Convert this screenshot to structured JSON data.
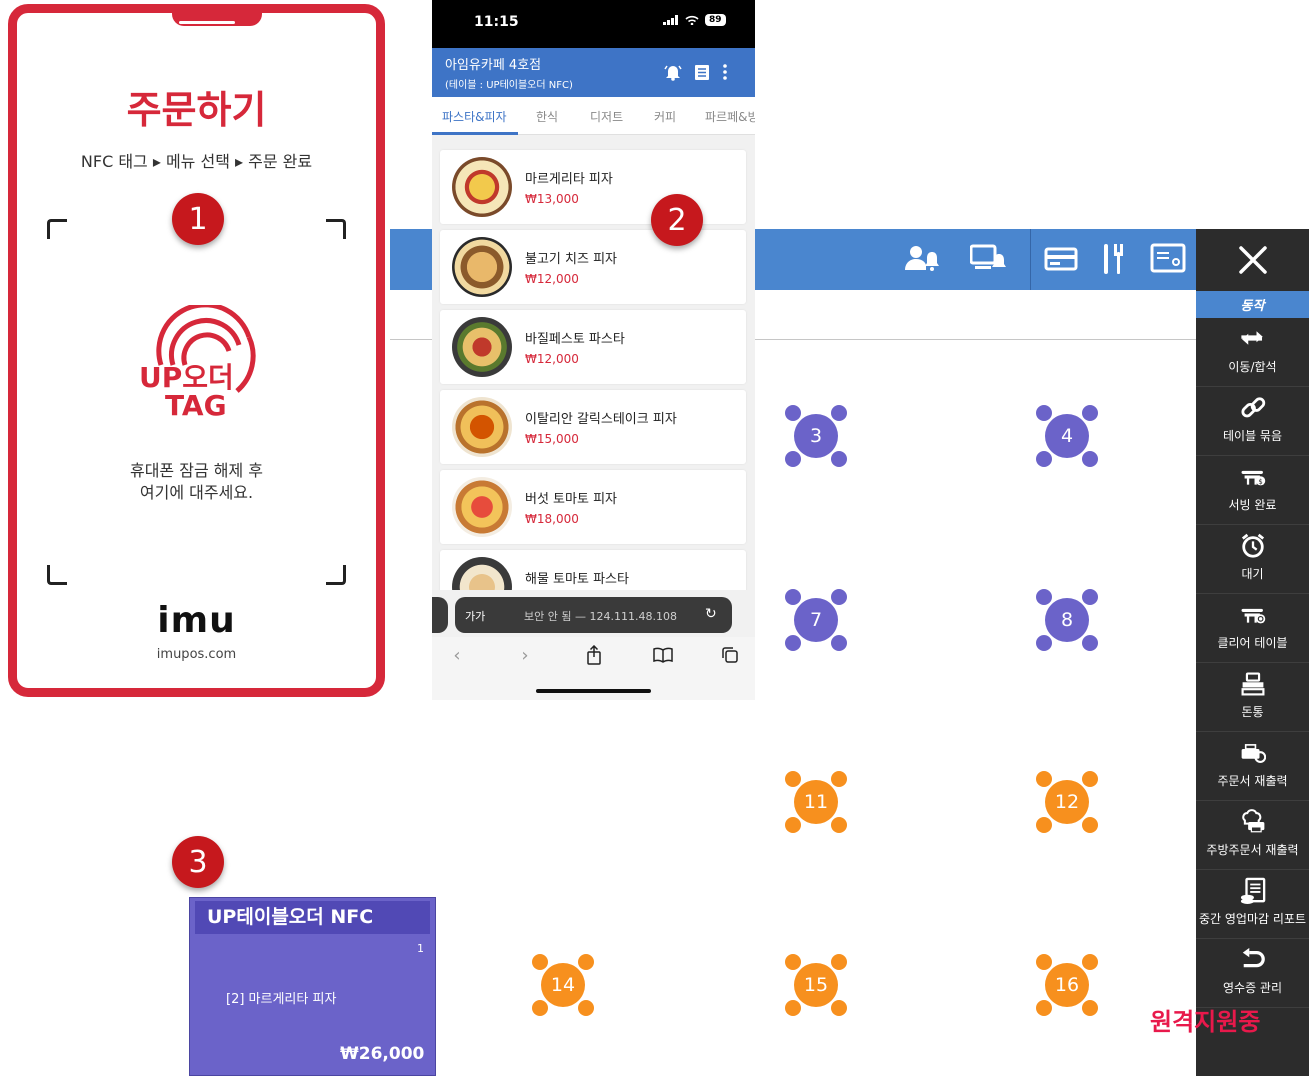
{
  "nfc_card": {
    "title": "주문하기",
    "steps": "NFC 태그 ▸ 메뉴 선택 ▸ 주문 완료",
    "logo_text_1": "UP오더",
    "logo_text_2": "TAG",
    "instruction_line1": "휴대폰 잠금 해제 후",
    "instruction_line2": "여기에 대주세요.",
    "brand": "imu",
    "site": "imupos.com",
    "accent_color": "#d6283a"
  },
  "badges": [
    "1",
    "2",
    "3"
  ],
  "phone": {
    "status": {
      "time": "11:15",
      "battery": "89"
    },
    "appbar": {
      "store_name": "아임유카페 4호점",
      "table_label": "(테이블 : UP테이블오더 NFC)"
    },
    "tabs": [
      "파스타&피자",
      "한식",
      "디저트",
      "커피",
      "파르페&빙"
    ],
    "active_tab": "파스타&피자",
    "menu_items": [
      {
        "name": "마르게리타 피자",
        "price": "₩13,000"
      },
      {
        "name": "불고기 치즈 피자",
        "price": "₩12,000"
      },
      {
        "name": "바질페스토 파스타",
        "price": "₩12,000"
      },
      {
        "name": "이탈리안 갈릭스테이크 피자",
        "price": "₩15,000"
      },
      {
        "name": "버섯 토마토 피자",
        "price": "₩18,000"
      },
      {
        "name": "해물 토마토 파스타",
        "price": ""
      }
    ],
    "urlbar": {
      "aa": "가가",
      "address": "보안 안 됨 — 124.111.48.108"
    }
  },
  "pos": {
    "tables_purple": [
      "3",
      "4",
      "7",
      "8"
    ],
    "tables_orange": [
      "11",
      "12",
      "14",
      "15",
      "16"
    ],
    "purple_color": "#6b63c9",
    "orange_color": "#f7901e"
  },
  "side_panel": {
    "section_label": "동작",
    "items": [
      {
        "label": "이동/합석",
        "icon": "swap-icon"
      },
      {
        "label": "테이블 묶음",
        "icon": "link-icon"
      },
      {
        "label": "서빙 완료",
        "icon": "serving-icon"
      },
      {
        "label": "대기",
        "icon": "alarm-icon"
      },
      {
        "label": "클리어 테이블",
        "icon": "clear-table-icon"
      },
      {
        "label": "돈통",
        "icon": "cash-drawer-icon"
      },
      {
        "label": "주문서 재출력",
        "icon": "reprint-icon"
      },
      {
        "label": "주방주문서 재출력",
        "icon": "kitchen-print-icon"
      },
      {
        "label": "중간 영업마감 리포트",
        "icon": "report-icon"
      },
      {
        "label": "영수증 관리",
        "icon": "receipt-icon"
      }
    ]
  },
  "ticket": {
    "header": "UP테이블오더 NFC",
    "count": "1",
    "line": "[2] 마르게리타 피자",
    "total": "₩26,000"
  },
  "watermark": "원격지원중"
}
